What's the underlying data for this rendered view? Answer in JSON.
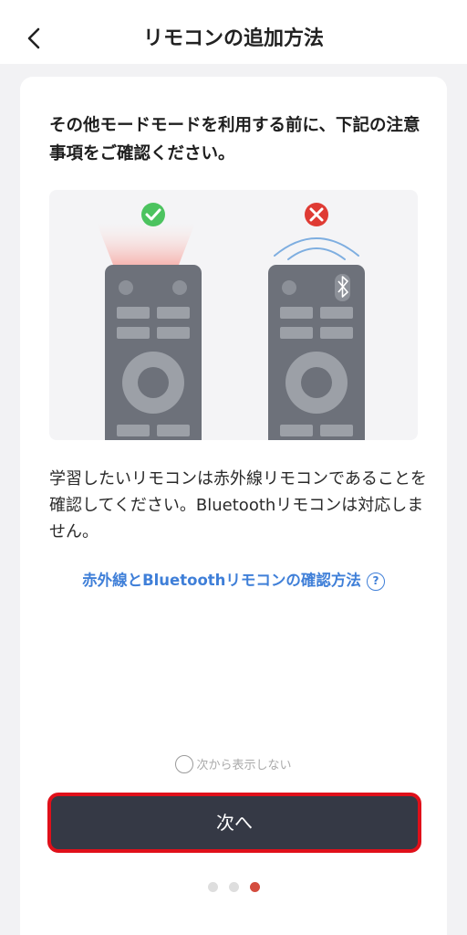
{
  "header": {
    "title": "リモコンの追加方法",
    "back_icon": "chevron-left-icon"
  },
  "content": {
    "intro": "その他モードモードを利用する前に、下記の注意事項をご確認ください。",
    "illustration": {
      "ok_icon": "check-circle-icon",
      "ng_icon": "cross-circle-icon",
      "bluetooth_icon": "bluetooth-icon",
      "ok_color": "#4cc35f",
      "ng_color": "#df3b34"
    },
    "description": "学習したいリモコンは赤外線リモコンであることを確認してください。Bluetoothリモコンは対応しません。",
    "help_link": "赤外線とBluetoothリモコンの確認方法",
    "help_icon": "?"
  },
  "footer": {
    "dont_show_label": "次から表示しない",
    "next_label": "次へ",
    "page_count": 3,
    "current_page": 3
  },
  "colors": {
    "accent_link": "#3f7fd8",
    "button_bg": "#353945",
    "highlight_border": "#e0101a",
    "active_dot": "#d44c3e"
  }
}
